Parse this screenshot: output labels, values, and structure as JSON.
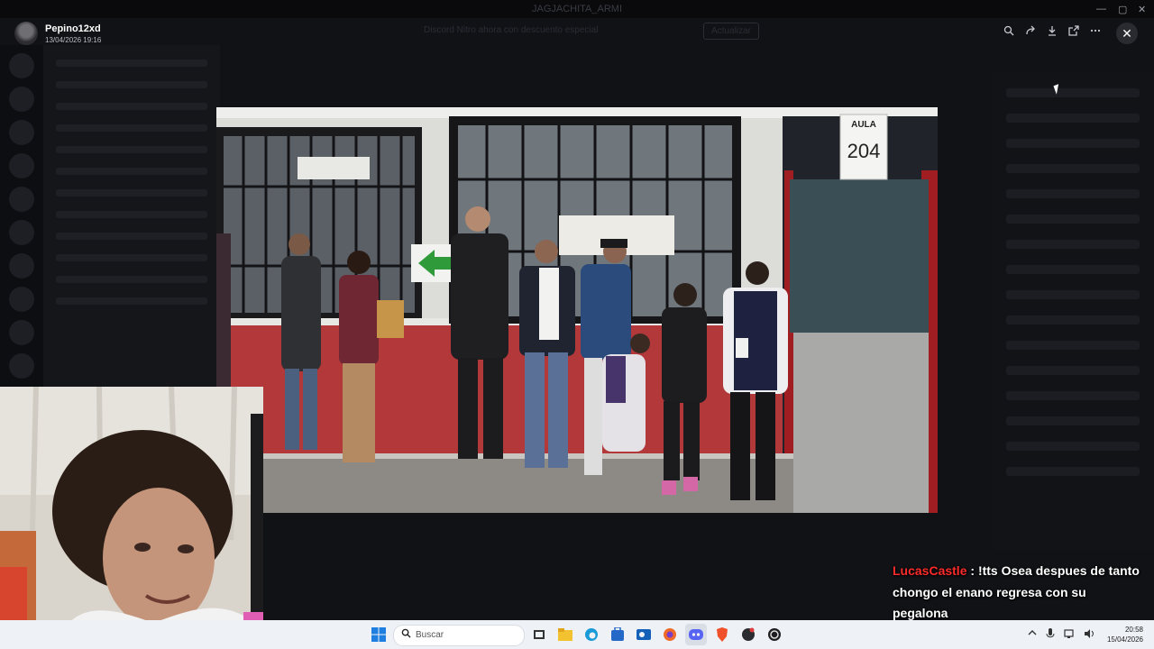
{
  "window": {
    "title": "JAGJACHITA_ARMI"
  },
  "banner": {
    "text": "Discord Nitro ahora con descuento especial",
    "button": "Actualizar"
  },
  "viewer": {
    "username": "Pepino12xd",
    "date": "13/04/2026 19:16",
    "tools": [
      "zoom-icon",
      "forward-icon",
      "download-icon",
      "open-external-icon",
      "more-icon"
    ],
    "close": "✕"
  },
  "photo": {
    "sign_label": "AULA",
    "sign_number": "204"
  },
  "chat": {
    "author": "LucasCastle",
    "separator": " : ",
    "message": "!tts Osea despues de tanto chongo el enano regresa con su pegalona"
  },
  "taskbar": {
    "search_placeholder": "Buscar",
    "time": "20:58",
    "date": "15/04/2026"
  }
}
